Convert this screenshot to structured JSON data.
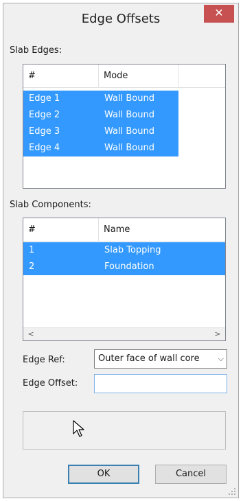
{
  "window": {
    "title": "Edge Offsets",
    "close_glyph": "✕"
  },
  "slab_edges": {
    "label": "Slab Edges:",
    "columns": [
      "#",
      "Mode"
    ],
    "rows": [
      {
        "id": "Edge 1",
        "mode": "Wall Bound"
      },
      {
        "id": "Edge 2",
        "mode": "Wall Bound"
      },
      {
        "id": "Edge 3",
        "mode": "Wall Bound"
      },
      {
        "id": "Edge 4",
        "mode": "Wall Bound"
      }
    ]
  },
  "slab_components": {
    "label": "Slab Components:",
    "columns": [
      "#",
      "Name"
    ],
    "rows": [
      {
        "id": "1",
        "name": "Slab Topping"
      },
      {
        "id": "2",
        "name": "Foundation"
      }
    ],
    "scroll_left": "<",
    "scroll_right": ">"
  },
  "edge_ref": {
    "label": "Edge Ref:",
    "value": "Outer face of wall core"
  },
  "edge_offset": {
    "label": "Edge Offset:",
    "value": ""
  },
  "buttons": {
    "ok": "OK",
    "cancel": "Cancel"
  },
  "colors": {
    "selection": "#3399ff",
    "close": "#c75050"
  }
}
